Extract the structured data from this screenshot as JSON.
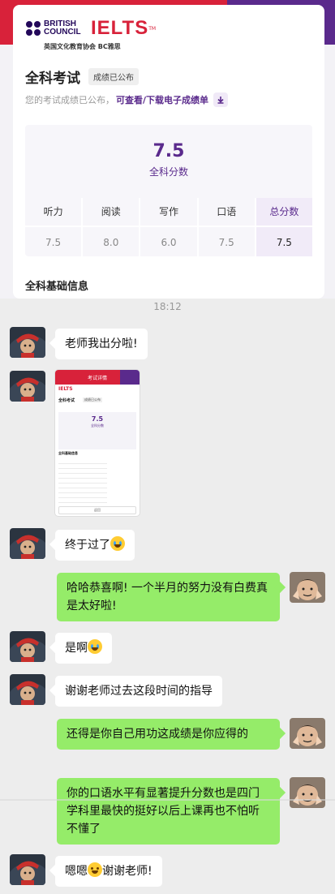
{
  "header": {
    "brand_line1": "BRITISH",
    "brand_line2": "COUNCIL",
    "ielts": "IELTS",
    "tm": "TM",
    "brand_sub": "英国文化教育协会 BC雅思",
    "title": "全科考试",
    "status_badge": "成绩已公布",
    "desc": "您的考试成绩已公布，",
    "download_link": "可查看/下载电子成绩单",
    "overall_score": "7.5",
    "overall_label": "全科分数",
    "scores": [
      {
        "label": "听力",
        "value": "7.5"
      },
      {
        "label": "阅读",
        "value": "8.0"
      },
      {
        "label": "写作",
        "value": "6.0"
      },
      {
        "label": "口语",
        "value": "7.5"
      },
      {
        "label": "总分数",
        "value": "7.5"
      }
    ],
    "section_title": "全科基础信息"
  },
  "chat": {
    "time": "18:12",
    "messages": [
      {
        "from": "teacher",
        "text": "老师我出分啦!"
      },
      {
        "from": "teacher",
        "text": "[截图]"
      },
      {
        "from": "teacher",
        "text": "终于过了"
      },
      {
        "from": "me",
        "text": "哈哈恭喜啊! 一个半月的努力没有白费真是太好啦!"
      },
      {
        "from": "teacher",
        "text": "是啊"
      },
      {
        "from": "teacher",
        "text": "谢谢老师过去这段时间的指导"
      },
      {
        "from": "me",
        "text": "还得是你自己用功这成绩是你应得的"
      },
      {
        "from": "me",
        "text": "你的口语水平有显著提升分数也是四门学科里最快的挺好以后上课再也不怕听不懂了"
      },
      {
        "from": "teacher",
        "text_pre": "嗯嗯",
        "text_post": "谢谢老师!"
      }
    ]
  },
  "thumbnail": {
    "header_title": "考试详情",
    "page_title": "全科考试",
    "badge": "成绩已公布",
    "score": "7.5",
    "score_label": "全科分数",
    "section": "全科基础信息",
    "button": "返回"
  },
  "colors": {
    "brand_red": "#d8223a",
    "brand_purple": "#5a2a8c",
    "bubble_green": "#95ec69"
  },
  "icons": [
    "download-icon",
    "avatar",
    "emoji-cry",
    "emoji-grin"
  ]
}
